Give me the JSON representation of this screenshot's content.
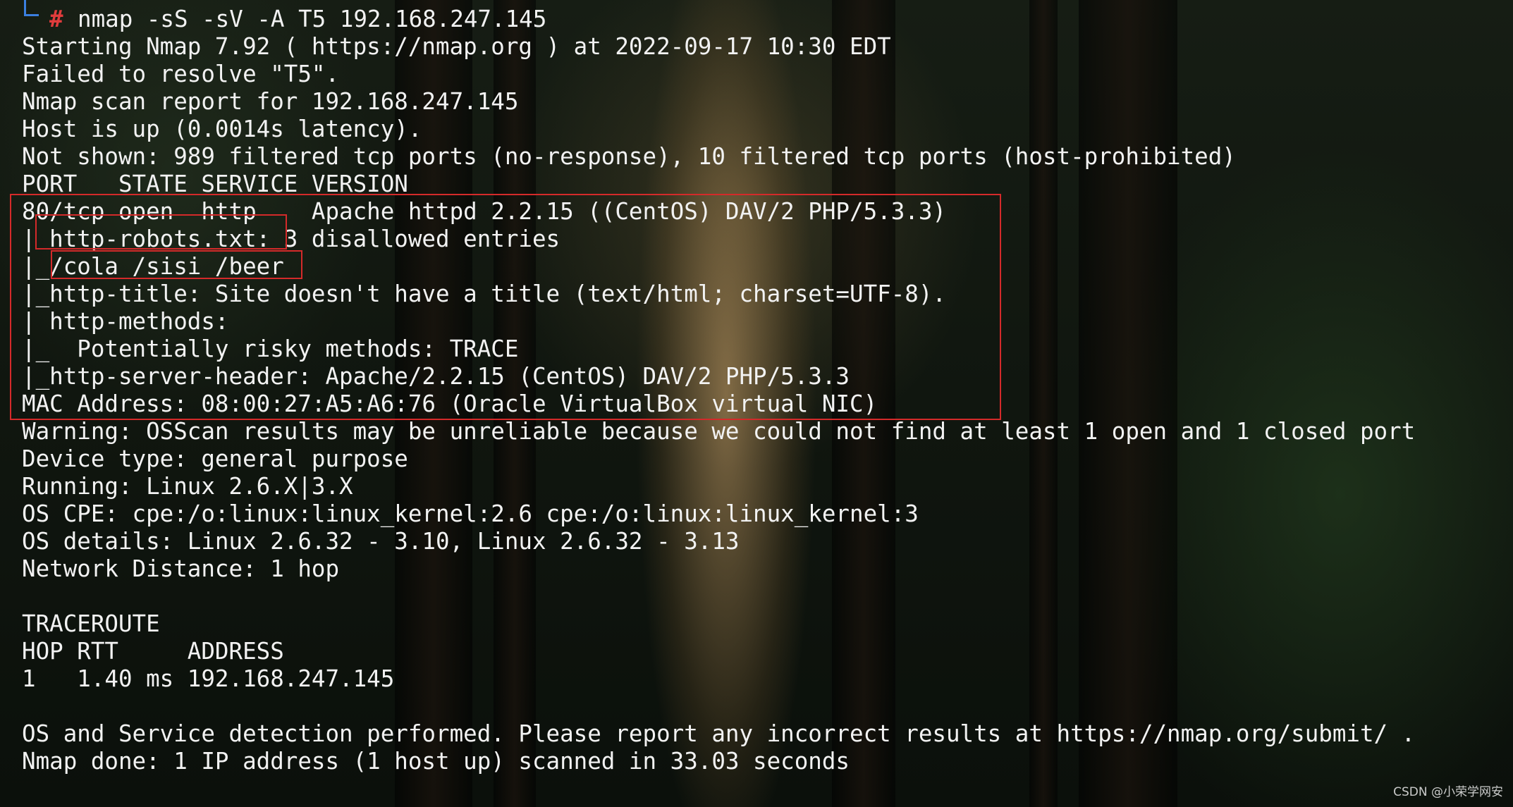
{
  "terminal": {
    "prompt_symbol": "#",
    "command": "nmap -sS -sV -A T5 192.168.247.145",
    "output_lines": [
      "Starting Nmap 7.92 ( https://nmap.org ) at 2022-09-17 10:30 EDT",
      "Failed to resolve \"T5\".",
      "Nmap scan report for 192.168.247.145",
      "Host is up (0.0014s latency).",
      "Not shown: 989 filtered tcp ports (no-response), 10 filtered tcp ports (host-prohibited)",
      "PORT   STATE SERVICE VERSION",
      "80/tcp open  http    Apache httpd 2.2.15 ((CentOS) DAV/2 PHP/5.3.3)",
      "| http-robots.txt: 3 disallowed entries",
      "|_/cola /sisi /beer",
      "|_http-title: Site doesn't have a title (text/html; charset=UTF-8).",
      "| http-methods:",
      "|_  Potentially risky methods: TRACE",
      "|_http-server-header: Apache/2.2.15 (CentOS) DAV/2 PHP/5.3.3",
      "MAC Address: 08:00:27:A5:A6:76 (Oracle VirtualBox virtual NIC)",
      "Warning: OSScan results may be unreliable because we could not find at least 1 open and 1 closed port",
      "Device type: general purpose",
      "Running: Linux 2.6.X|3.X",
      "OS CPE: cpe:/o:linux:linux_kernel:2.6 cpe:/o:linux:linux_kernel:3",
      "OS details: Linux 2.6.32 - 3.10, Linux 2.6.32 - 3.13",
      "Network Distance: 1 hop",
      "",
      "TRACEROUTE",
      "HOP RTT     ADDRESS",
      "1   1.40 ms 192.168.247.145",
      "",
      "OS and Service detection performed. Please report any incorrect results at https://nmap.org/submit/ .",
      "Nmap done: 1 IP address (1 host up) scanned in 33.03 seconds"
    ]
  },
  "watermark": "CSDN @小荣学网安",
  "colors": {
    "text": "#f2f2f2",
    "prompt_hash": "#e03c3c",
    "prompt_frame": "#3b7fe0",
    "highlight_box": "#d42a2a"
  }
}
